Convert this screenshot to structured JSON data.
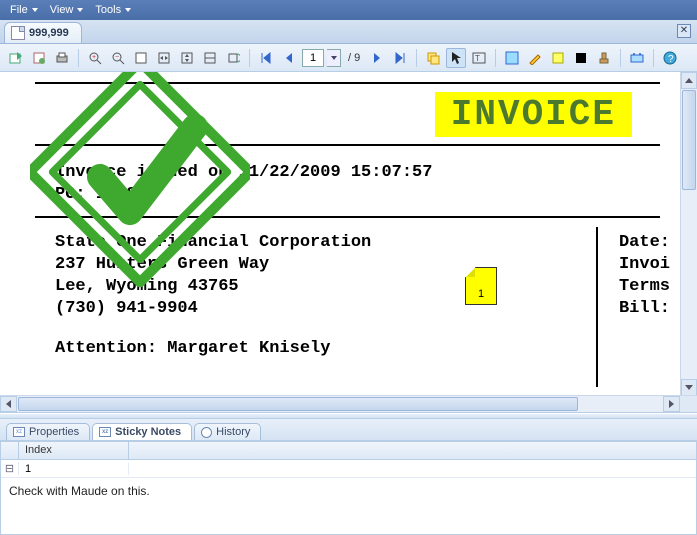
{
  "menu": {
    "file": "File",
    "view": "View",
    "tools": "Tools"
  },
  "tab": {
    "label": "999,999"
  },
  "toolbar": {
    "page_current": "1",
    "page_total": "/ 9"
  },
  "document": {
    "invoice_title": "INVOICE",
    "issued_line": "Invoice issued on 11/22/2009 15:07:57",
    "po_line": "PO: 106895",
    "company": "State One Financial Corporation",
    "street": "237 Hunters Green Way",
    "city_state_zip": "Lee, Wyoming  43765",
    "phone": "(730) 941-9904",
    "attention": "Attention: Margaret Knisely",
    "right_labels": {
      "date": "Date:",
      "invoice": "Invoi",
      "terms": "Terms",
      "bill": "Bill:"
    },
    "sticky_index": "1"
  },
  "bottom": {
    "tab_properties": "Properties",
    "tab_sticky": "Sticky Notes",
    "tab_history": "History",
    "grid_header_index": "Index",
    "row1_index": "1",
    "note_text": "Check with Maude on this."
  },
  "icons": {
    "expand": "⊟"
  }
}
